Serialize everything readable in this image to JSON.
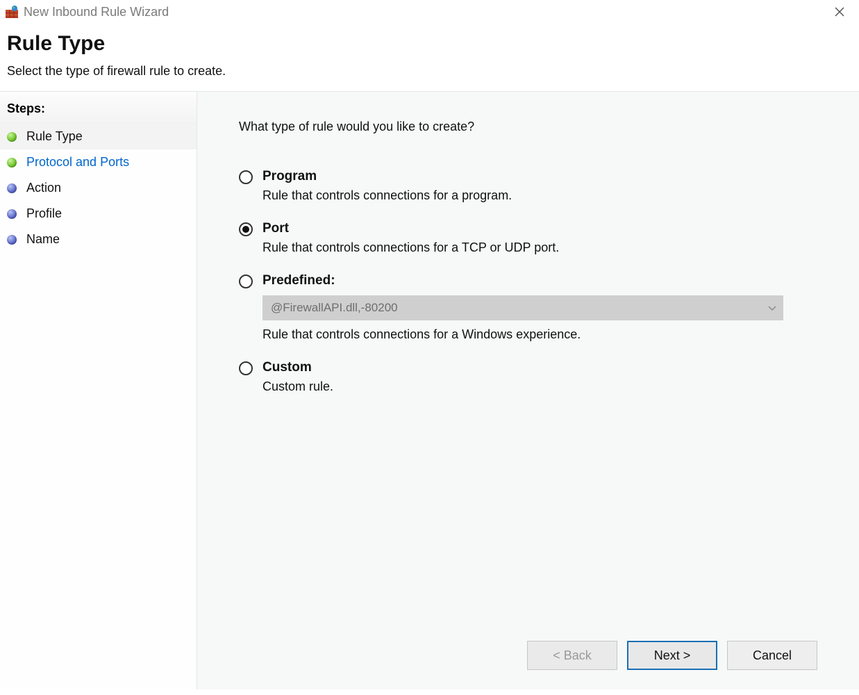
{
  "window": {
    "title": "New Inbound Rule Wizard"
  },
  "header": {
    "title": "Rule Type",
    "subtitle": "Select the type of firewall rule to create."
  },
  "sidebar": {
    "heading": "Steps:",
    "items": [
      {
        "label": "Rule Type",
        "bullet": "green",
        "state": "active"
      },
      {
        "label": "Protocol and Ports",
        "bullet": "green",
        "state": "clickable"
      },
      {
        "label": "Action",
        "bullet": "blue",
        "state": "pending"
      },
      {
        "label": "Profile",
        "bullet": "blue",
        "state": "pending"
      },
      {
        "label": "Name",
        "bullet": "blue",
        "state": "pending"
      }
    ]
  },
  "main": {
    "prompt": "What type of rule would you like to create?",
    "options": {
      "program": {
        "label": "Program",
        "desc": "Rule that controls connections for a program.",
        "selected": false
      },
      "port": {
        "label": "Port",
        "desc": "Rule that controls connections for a TCP or UDP port.",
        "selected": true
      },
      "predefined": {
        "label": "Predefined:",
        "select_value": "@FirewallAPI.dll,-80200",
        "desc": "Rule that controls connections for a Windows experience.",
        "selected": false
      },
      "custom": {
        "label": "Custom",
        "desc": "Custom rule.",
        "selected": false
      }
    }
  },
  "footer": {
    "back": "< Back",
    "next": "Next >",
    "cancel": "Cancel"
  }
}
